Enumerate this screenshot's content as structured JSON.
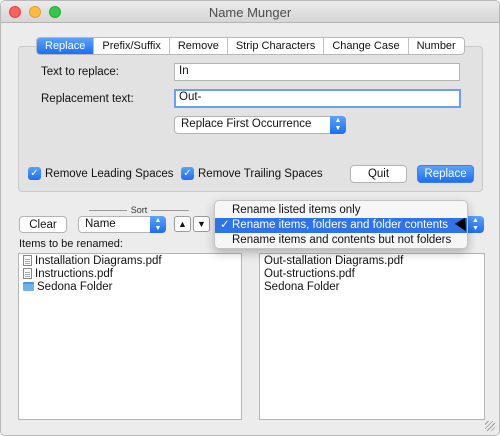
{
  "window": {
    "title": "Name Munger"
  },
  "tabs": [
    {
      "label": "Replace",
      "active": true
    },
    {
      "label": "Prefix/Suffix",
      "active": false
    },
    {
      "label": "Remove",
      "active": false
    },
    {
      "label": "Strip Characters",
      "active": false
    },
    {
      "label": "Change Case",
      "active": false
    },
    {
      "label": "Number",
      "active": false
    }
  ],
  "replace": {
    "text_to_replace_label": "Text to replace:",
    "text_to_replace_value": "In",
    "replacement_label": "Replacement text:",
    "replacement_value": "Out-",
    "occurrence_value": "Replace First Occurrence"
  },
  "options": {
    "remove_leading": "Remove Leading Spaces",
    "remove_trailing": "Remove Trailing Spaces"
  },
  "buttons": {
    "quit": "Quit",
    "replace": "Replace",
    "clear": "Clear"
  },
  "sort": {
    "label": "Sort",
    "value": "Name",
    "up": "▲",
    "down": "▼"
  },
  "items_label": "Items to be renamed:",
  "rename_menu": {
    "items": [
      {
        "label": "Rename listed items only",
        "selected": false
      },
      {
        "label": "Rename items, folders and folder contents",
        "selected": true
      },
      {
        "label": "Rename items and contents but not folders",
        "selected": false
      }
    ]
  },
  "original_items": [
    {
      "name": "Installation Diagrams.pdf",
      "icon": "pdf-document-icon"
    },
    {
      "name": "Instructions.pdf",
      "icon": "pdf-document-icon"
    },
    {
      "name": "Sedona Folder",
      "icon": "folder-icon"
    }
  ],
  "renamed_items": [
    {
      "name": "Out-stallation Diagrams.pdf"
    },
    {
      "name": "Out-structions.pdf"
    },
    {
      "name": "Sedona Folder"
    }
  ],
  "colors": {
    "accent": "#1d6ef2",
    "menu_highlight": "#2f73eb"
  }
}
